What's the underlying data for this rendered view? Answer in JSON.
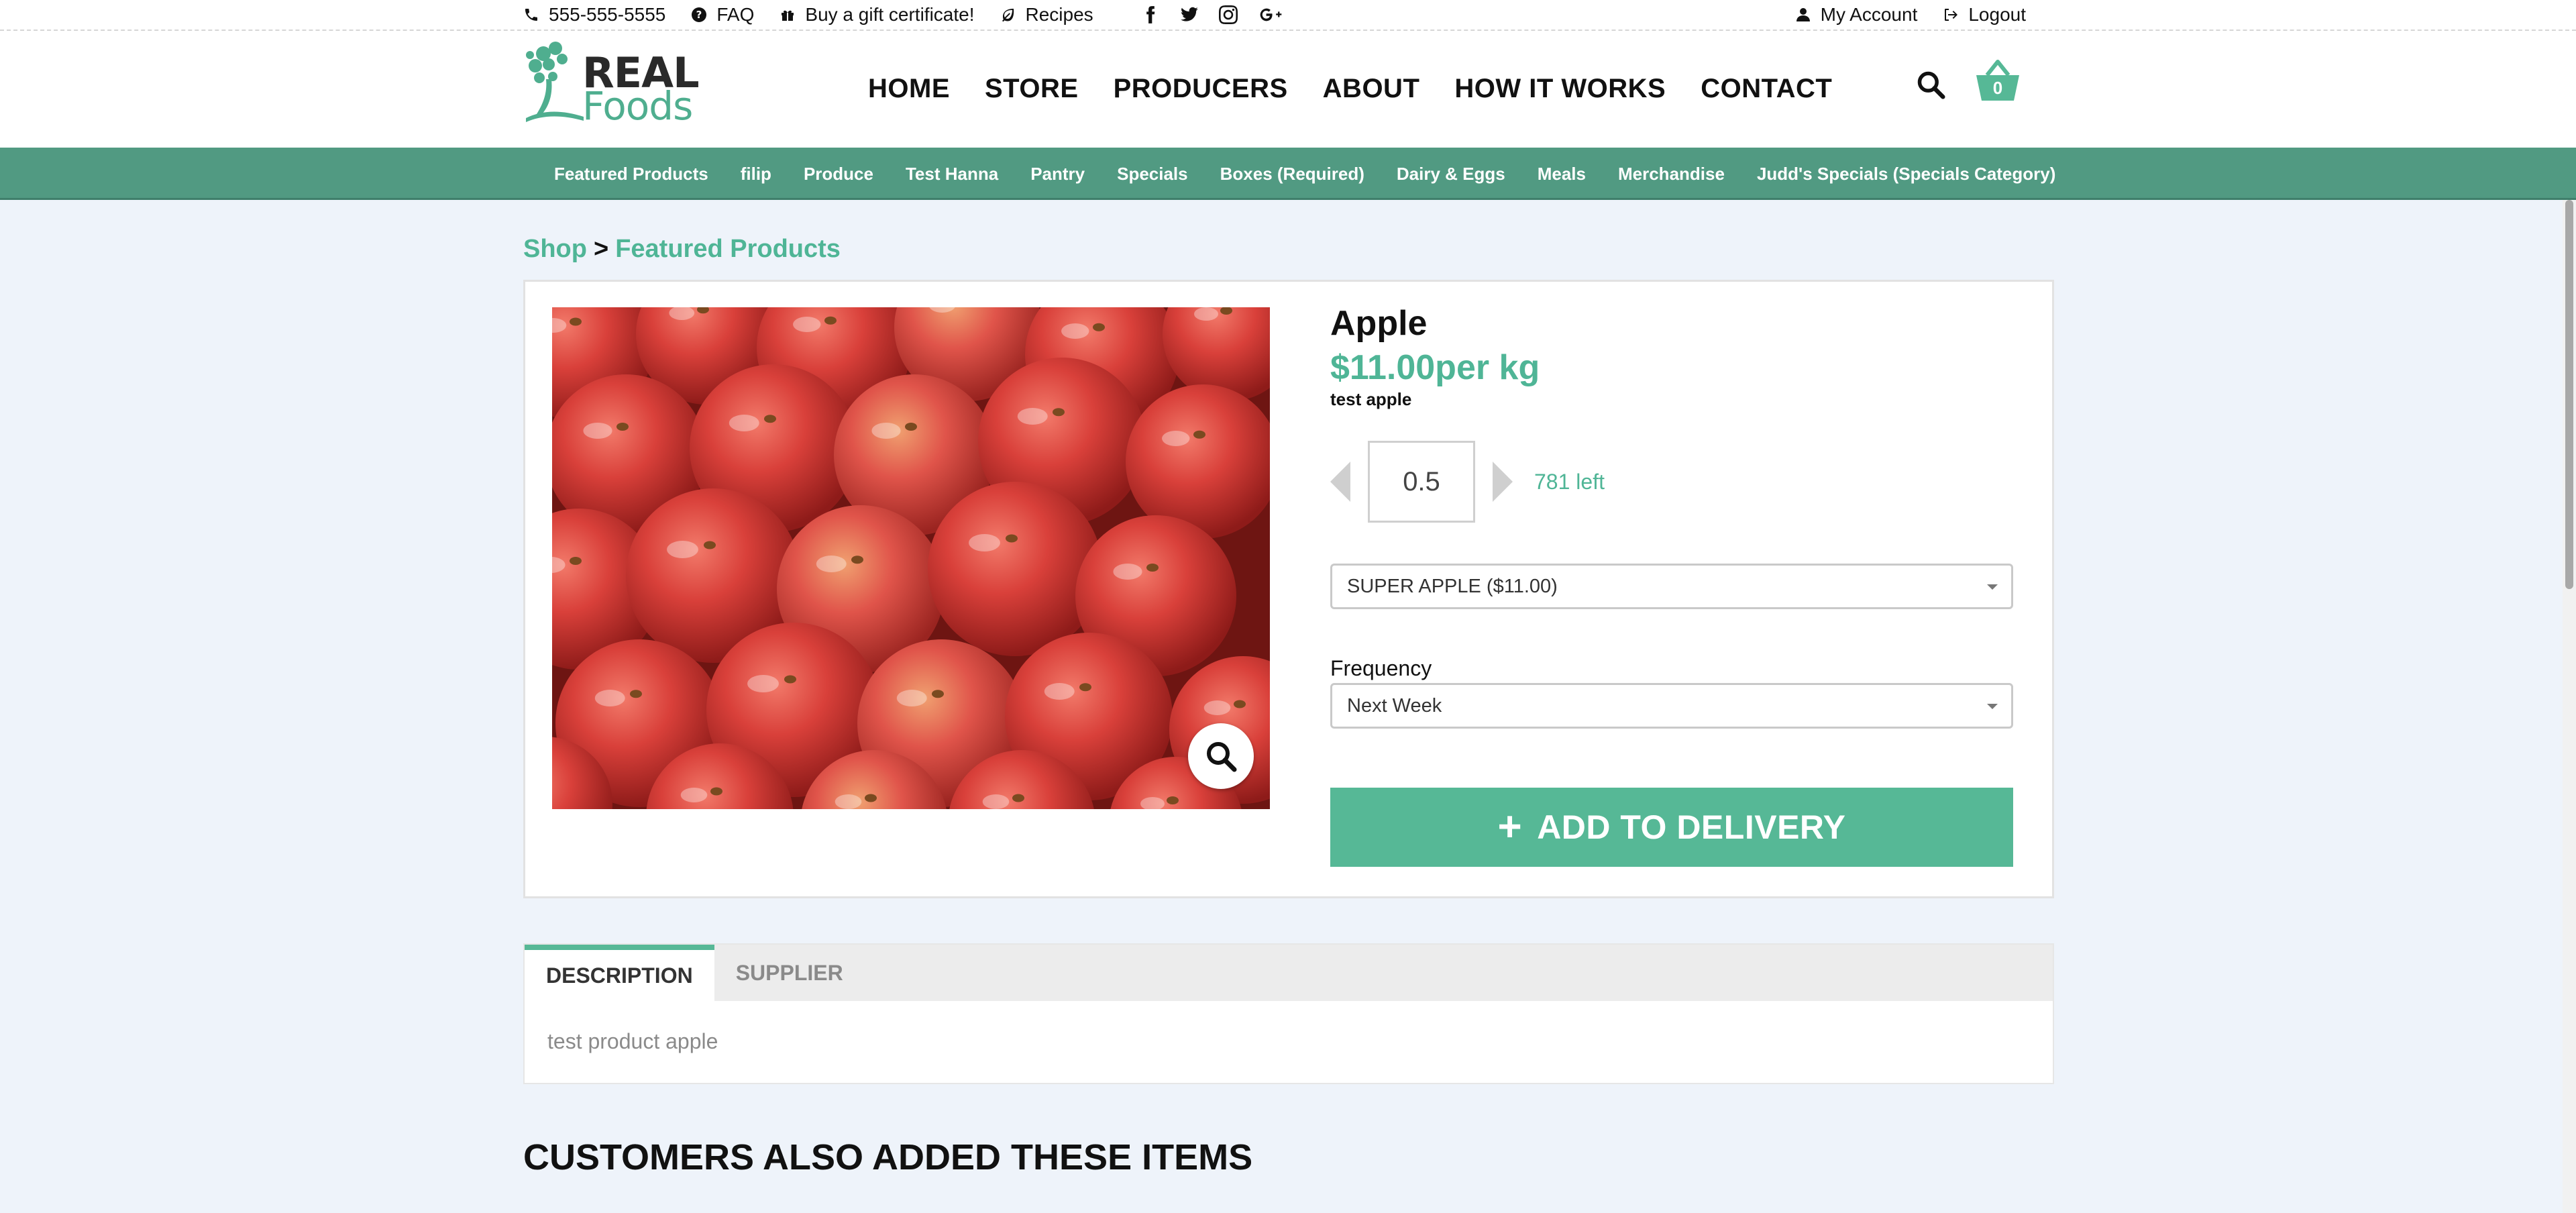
{
  "topbar": {
    "phone": "555-555-5555",
    "faq": "FAQ",
    "gift": "Buy a gift certificate!",
    "recipes": "Recipes",
    "account": "My Account",
    "logout": "Logout"
  },
  "logo": {
    "line1": "REAL",
    "line2": "Foods"
  },
  "nav": [
    "HOME",
    "STORE",
    "PRODUCERS",
    "ABOUT",
    "HOW IT WORKS",
    "CONTACT"
  ],
  "cart": {
    "count": "0"
  },
  "categories": [
    "Featured Products",
    "filip",
    "Produce",
    "Test Hanna",
    "Pantry",
    "Specials",
    "Boxes (Required)",
    "Dairy & Eggs",
    "Meals",
    "Merchandise",
    "Judd's Specials (Specials Category)"
  ],
  "breadcrumb": {
    "shop": "Shop",
    "sep": ">",
    "current": "Featured Products"
  },
  "product": {
    "name": "Apple",
    "price": "$11.00per kg",
    "subtitle": "test apple",
    "quantity": "0.5",
    "stock": "781 left",
    "variant": "SUPER APPLE ($11.00)",
    "frequency_label": "Frequency",
    "frequency": "Next Week",
    "add_button": "ADD TO DELIVERY"
  },
  "tabs": {
    "items": [
      "DESCRIPTION",
      "SUPPLIER"
    ],
    "active": "DESCRIPTION",
    "content": "test product apple"
  },
  "related_title": "CUSTOMERS ALSO ADDED THESE ITEMS",
  "colors": {
    "accent": "#56b896",
    "catbar": "#519a82",
    "background": "#eef3fa"
  }
}
